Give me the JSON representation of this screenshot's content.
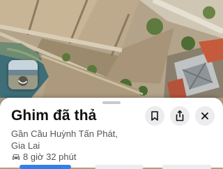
{
  "pin_card": {
    "title": "Ghim đã thả",
    "address_line1": "Gần Cầu Huỳnh Tấn Phát,",
    "address_line2": "Gia Lai",
    "travel_time": "8 giờ 32 phút"
  },
  "icons": {
    "save": "bookmark-icon",
    "share": "share-icon",
    "close": "close-icon",
    "car": "car-icon",
    "look_around": "look-around-icon"
  },
  "colors": {
    "sheet_background": "#ffffff",
    "title_text": "#111111",
    "secondary_text": "#555555",
    "round_button": "#ececee",
    "action_button_accent": "#2f80ed"
  }
}
